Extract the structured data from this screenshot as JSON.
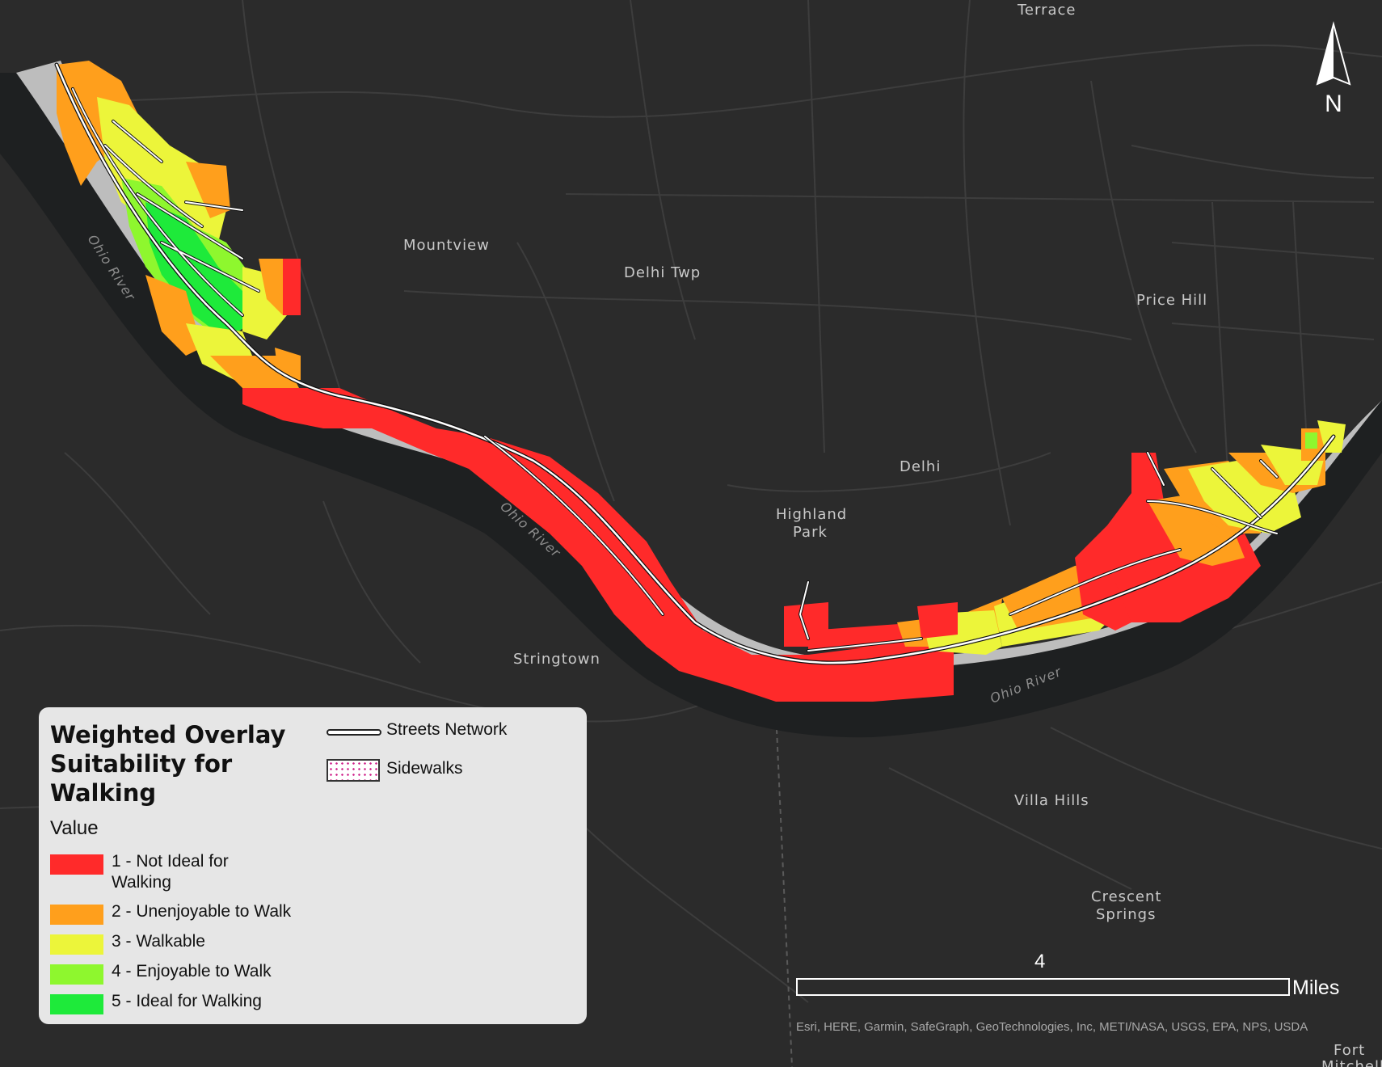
{
  "map": {
    "places": [
      {
        "name": "Terrace"
      },
      {
        "name": "Mountview"
      },
      {
        "name": "Delhi Twp"
      },
      {
        "name": "Price Hill"
      },
      {
        "name": "Delhi"
      },
      {
        "name": "Highland"
      },
      {
        "name": "Park"
      },
      {
        "name": "Stringtown"
      },
      {
        "name": "Villa Hills"
      },
      {
        "name": "Crescent"
      },
      {
        "name": "Springs"
      },
      {
        "name": "Fort"
      },
      {
        "name": "Mitchell"
      }
    ],
    "river_labels": [
      "Ohio River",
      "Ohio River",
      "Ohio River"
    ],
    "north_arrow": {
      "label": "N"
    },
    "colors": {
      "background": "#2b2b2b",
      "river": "#1e2021",
      "roads": "#3c3c3c"
    }
  },
  "legend": {
    "title": "Weighted Overlay Suitability for Walking",
    "subtitle": "Value",
    "classes": [
      {
        "label": "1 - Not Ideal for Walking",
        "color": "#ff2a2a"
      },
      {
        "label": "2 - Unenjoyable to Walk",
        "color": "#ff9f1c"
      },
      {
        "label": "3 - Walkable",
        "color": "#ecf53a"
      },
      {
        "label": "4 - Enjoyable to Walk",
        "color": "#8ef72e"
      },
      {
        "label": "5 - Ideal for Walking",
        "color": "#1eea3a"
      }
    ],
    "streets_label": "Streets Network",
    "sidewalks_label": "Sidewalks"
  },
  "scale_bar": {
    "value": "4",
    "unit": "Miles"
  },
  "attribution": "Esri, HERE, Garmin, SafeGraph, GeoTechnologies, Inc, METI/NASA, USGS, EPA, NPS, USDA"
}
